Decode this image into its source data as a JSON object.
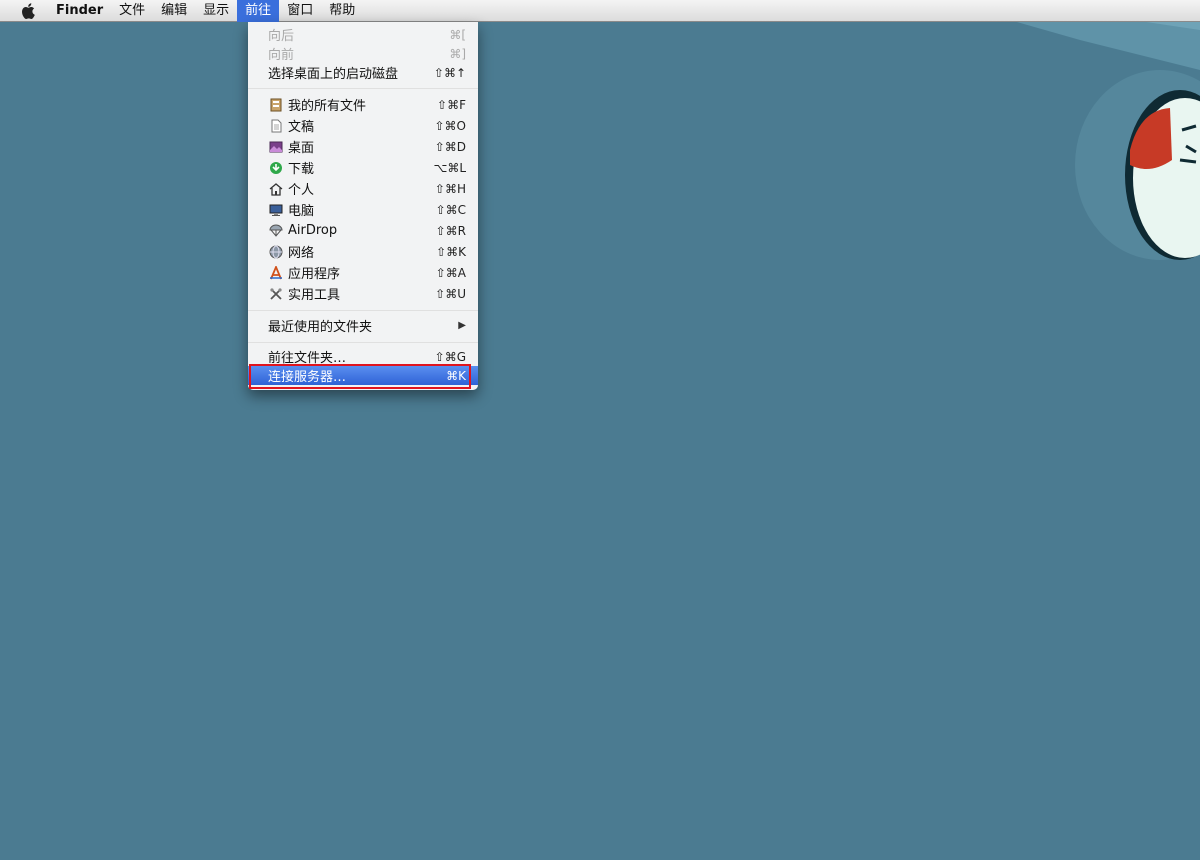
{
  "menubar": {
    "items": [
      {
        "label": "Finder"
      },
      {
        "label": "文件"
      },
      {
        "label": "编辑"
      },
      {
        "label": "显示"
      },
      {
        "label": "前往"
      },
      {
        "label": "窗口"
      },
      {
        "label": "帮助"
      }
    ]
  },
  "go_menu": {
    "items": [
      {
        "label": "向后",
        "shortcut": "⌘[",
        "enabled": false
      },
      {
        "label": "向前",
        "shortcut": "⌘]",
        "enabled": false
      },
      {
        "label": "选择桌面上的启动磁盘",
        "shortcut": "⇧⌘↑"
      },
      {
        "label": "我的所有文件",
        "shortcut": "⇧⌘F",
        "icon": "all-my-files-icon"
      },
      {
        "label": "文稿",
        "shortcut": "⇧⌘O",
        "icon": "documents-icon"
      },
      {
        "label": "桌面",
        "shortcut": "⇧⌘D",
        "icon": "desktop-icon"
      },
      {
        "label": "下载",
        "shortcut": "⌥⌘L",
        "icon": "downloads-icon"
      },
      {
        "label": "个人",
        "shortcut": "⇧⌘H",
        "icon": "home-icon"
      },
      {
        "label": "电脑",
        "shortcut": "⇧⌘C",
        "icon": "computer-icon"
      },
      {
        "label": "AirDrop",
        "shortcut": "⇧⌘R",
        "icon": "airdrop-icon"
      },
      {
        "label": "网络",
        "shortcut": "⇧⌘K",
        "icon": "network-icon"
      },
      {
        "label": "应用程序",
        "shortcut": "⇧⌘A",
        "icon": "applications-icon"
      },
      {
        "label": "实用工具",
        "shortcut": "⇧⌘U",
        "icon": "utilities-icon"
      },
      {
        "label": "最近使用的文件夹",
        "submenu_indicator": "▶"
      },
      {
        "label": "前往文件夹…",
        "shortcut": "⇧⌘G"
      },
      {
        "label": "连接服务器…",
        "shortcut": "⌘K",
        "selected": true
      }
    ]
  },
  "colors": {
    "desktop": "#4b7b91",
    "menu_selection": "#3a6fdc",
    "annotation_box": "#e0141e"
  }
}
